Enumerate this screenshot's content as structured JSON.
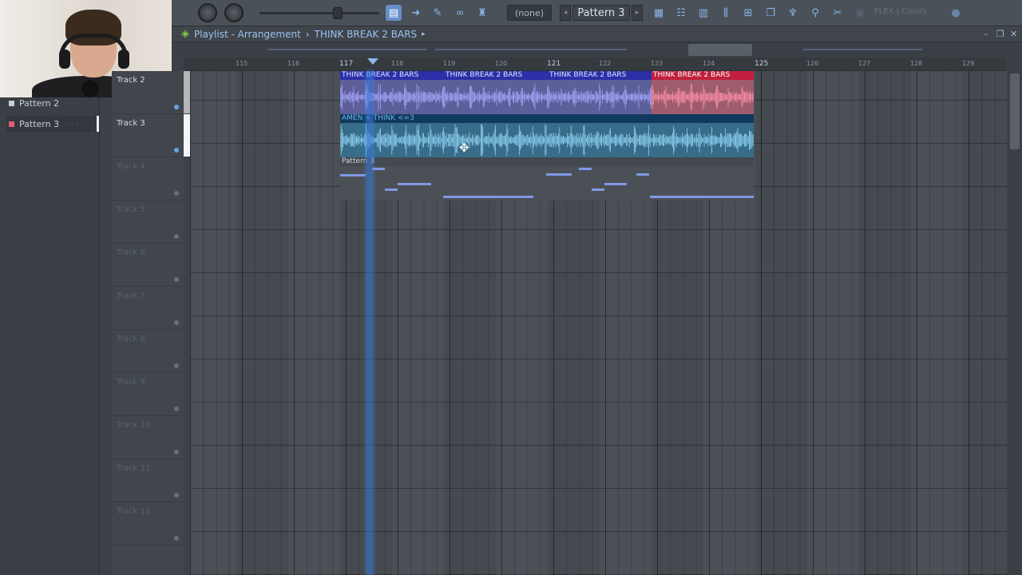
{
  "toolbar": {
    "pattern_selector": "(none)",
    "pattern_name": "Pattern 3",
    "flex_label": "FLEX | Colors",
    "colors": {
      "accent": "#6790c9",
      "icon": "#88b6ea"
    }
  },
  "browser": {
    "patterns": [
      {
        "label": "Pattern 2",
        "selected": false
      },
      {
        "label": "Pattern 3",
        "selected": true
      }
    ]
  },
  "playlist": {
    "title": "Playlist - Arrangement",
    "separator": "›",
    "clip_name": "THINK BREAK 2 BARS",
    "ruler": [
      "115",
      "116",
      "117",
      "118",
      "119",
      "120",
      "121",
      "122",
      "123",
      "124",
      "125",
      "126",
      "127",
      "128",
      "129"
    ],
    "ruler_bold": [
      "117",
      "121",
      "125"
    ],
    "tracks": [
      "Track 2",
      "Track 3",
      "Track 4",
      "Track 5",
      "Track 6",
      "Track 7",
      "Track 8",
      "Track 9",
      "Track 10",
      "Track 11",
      "Track 12"
    ],
    "clips": {
      "think1": "THINK BREAK 2 BARS",
      "think2": "THINK BREAK 2 BARS",
      "think3": "THINK BREAK 2 BARS",
      "think4": "THINK BREAK 2 BARS",
      "amen": "AMEN + THINK <=3",
      "pattern3": "Pattern 3"
    },
    "colors": {
      "think_clip": "#2b2fa8",
      "think_clip_red": "#c0203d",
      "amen_clip": "#386d8a",
      "notes": "#8098e6",
      "playhead": "#3778dc"
    }
  }
}
